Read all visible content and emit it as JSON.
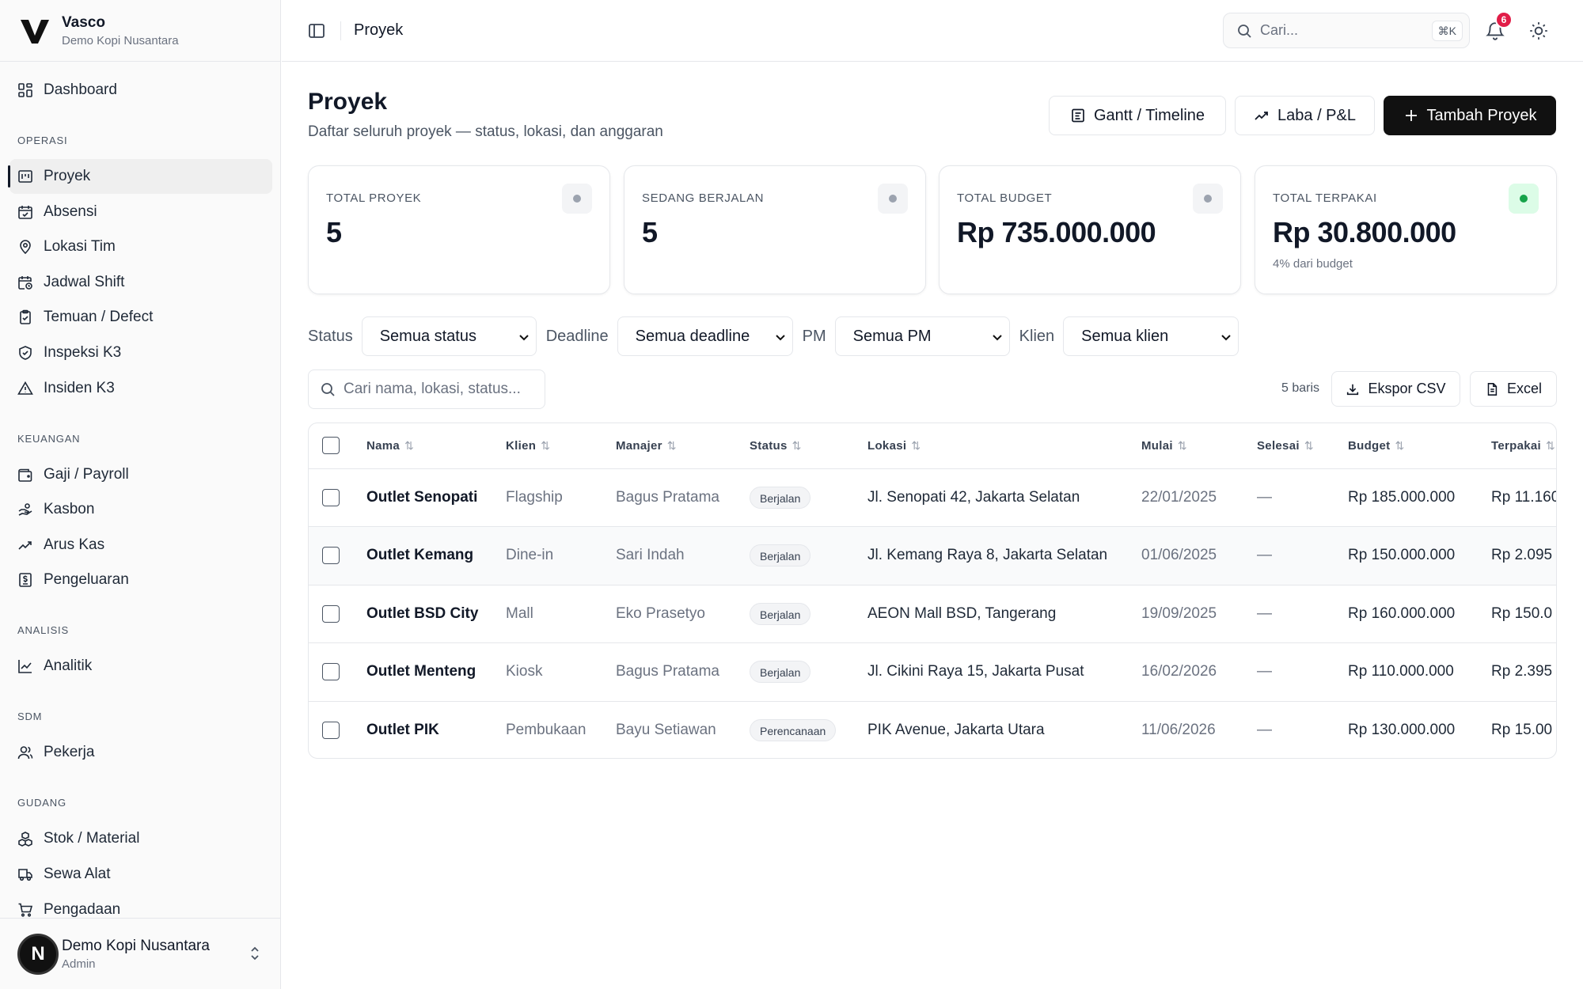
{
  "brand": {
    "name": "Vasco",
    "sub": "Demo Kopi Nusantara"
  },
  "sidebar": {
    "dashboard": "Dashboard",
    "sections": [
      {
        "title": "OPERASI",
        "items": [
          "Proyek",
          "Absensi",
          "Lokasi Tim",
          "Jadwal Shift",
          "Temuan / Defect",
          "Inspeksi K3",
          "Insiden K3"
        ]
      },
      {
        "title": "KEUANGAN",
        "items": [
          "Gaji / Payroll",
          "Kasbon",
          "Arus Kas",
          "Pengeluaran"
        ]
      },
      {
        "title": "ANALISIS",
        "items": [
          "Analitik"
        ]
      },
      {
        "title": "SDM",
        "items": [
          "Pekerja"
        ]
      },
      {
        "title": "GUDANG",
        "items": [
          "Stok / Material",
          "Sewa Alat",
          "Pengadaan"
        ]
      }
    ],
    "active": "Proyek"
  },
  "user": {
    "initial": "N",
    "name": "Demo Kopi Nusantara",
    "role": "Admin"
  },
  "topbar": {
    "breadcrumb": "Proyek",
    "search_placeholder": "Cari...",
    "shortcut": "⌘K",
    "notif_count": "6"
  },
  "page": {
    "title": "Proyek",
    "subtitle": "Daftar seluruh proyek — status, lokasi, dan anggaran",
    "buttons": {
      "gantt": "Gantt / Timeline",
      "pl": "Laba / P&L",
      "add": "Tambah Proyek"
    }
  },
  "stats": [
    {
      "label": "TOTAL PROYEK",
      "value": "5",
      "note": "",
      "dot": "gray"
    },
    {
      "label": "SEDANG BERJALAN",
      "value": "5",
      "note": "",
      "dot": "gray"
    },
    {
      "label": "TOTAL BUDGET",
      "value": "Rp 735.000.000",
      "note": "",
      "dot": "gray"
    },
    {
      "label": "TOTAL TERPAKAI",
      "value": "Rp 30.800.000",
      "note": "4% dari budget",
      "dot": "green"
    }
  ],
  "filters": {
    "status": {
      "label": "Status",
      "value": "Semua status"
    },
    "deadline": {
      "label": "Deadline",
      "value": "Semua deadline"
    },
    "pm": {
      "label": "PM",
      "value": "Semua PM"
    },
    "client": {
      "label": "Klien",
      "value": "Semua klien"
    }
  },
  "table_tools": {
    "search_placeholder": "Cari nama, lokasi, status...",
    "row_count": "5 baris",
    "export_csv": "Ekspor CSV",
    "excel": "Excel"
  },
  "table": {
    "columns": [
      "Nama",
      "Klien",
      "Manajer",
      "Status",
      "Lokasi",
      "Mulai",
      "Selesai",
      "Budget",
      "Terpakai"
    ],
    "rows": [
      {
        "name": "Outlet Senopati",
        "client": "Flagship",
        "manager": "Bagus Pratama",
        "status": "Berjalan",
        "location": "Jl. Senopati 42, Jakarta Selatan",
        "start": "22/01/2025",
        "end": "—",
        "budget": "Rp 185.000.000",
        "used": "Rp 11.160."
      },
      {
        "name": "Outlet Kemang",
        "client": "Dine-in",
        "manager": "Sari Indah",
        "status": "Berjalan",
        "location": "Jl. Kemang Raya 8, Jakarta Selatan",
        "start": "01/06/2025",
        "end": "—",
        "budget": "Rp 150.000.000",
        "used": "Rp 2.095"
      },
      {
        "name": "Outlet BSD City",
        "client": "Mall",
        "manager": "Eko Prasetyo",
        "status": "Berjalan",
        "location": "AEON Mall BSD, Tangerang",
        "start": "19/09/2025",
        "end": "—",
        "budget": "Rp 160.000.000",
        "used": "Rp 150.0"
      },
      {
        "name": "Outlet Menteng",
        "client": "Kiosk",
        "manager": "Bagus Pratama",
        "status": "Berjalan",
        "location": "Jl. Cikini Raya 15, Jakarta Pusat",
        "start": "16/02/2026",
        "end": "—",
        "budget": "Rp 110.000.000",
        "used": "Rp 2.395"
      },
      {
        "name": "Outlet PIK",
        "client": "Pembukaan",
        "manager": "Bayu Setiawan",
        "status": "Perencanaan",
        "location": "PIK Avenue, Jakarta Utara",
        "start": "11/06/2026",
        "end": "—",
        "budget": "Rp 130.000.000",
        "used": "Rp 15.00"
      }
    ]
  }
}
